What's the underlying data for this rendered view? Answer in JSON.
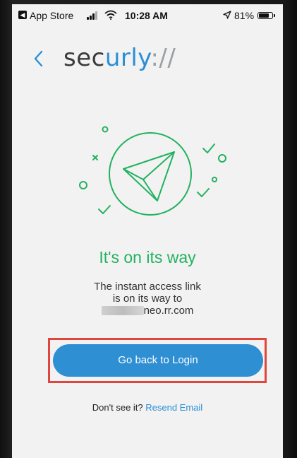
{
  "status_bar": {
    "back_app": "App Store",
    "time": "10:28 AM",
    "battery": "81%",
    "battery_level": 0.81
  },
  "header": {
    "back_glyph": "‹",
    "logo_sec": "sec",
    "logo_urly": "urly",
    "logo_slash": "://"
  },
  "main": {
    "headline": "It's on its way",
    "line1": "The instant access link",
    "line2": "is on its way to",
    "email_visible": "neo.rr.com",
    "login_button": "Go back to Login",
    "footer_prefix": "Don't see it?",
    "resend_link": "Resend Email"
  },
  "colors": {
    "accent_green": "#22b25f",
    "accent_blue": "#2f8fd3",
    "highlight_red": "#e0453e"
  }
}
